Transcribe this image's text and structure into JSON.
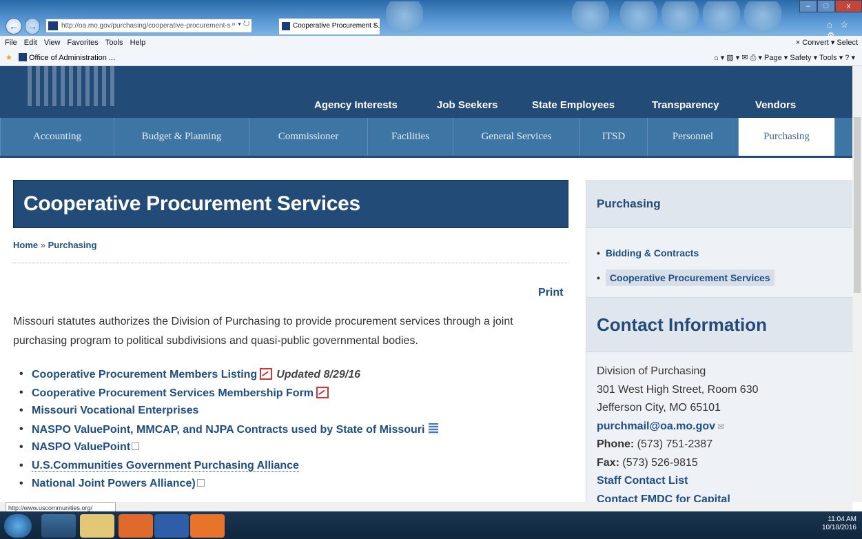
{
  "browser": {
    "url": "http://oa.mo.gov/purchasing/cooperative-procurement-s",
    "url_tools": "⌕ ▾ ↻",
    "tab_title": "Cooperative Procurement S...",
    "tab_close": "×",
    "window_controls": [
      "–",
      "□",
      "x"
    ],
    "toolbar_icons": "⌂ ☆ ⚙",
    "menu": [
      "File",
      "Edit",
      "View",
      "Favorites",
      "Tools",
      "Help"
    ],
    "menu_right": "×  Convert ▾  Select",
    "favorite": "Office of Administration ...",
    "command_bar": "⌂ ▾  ▧ ▾  ✉  ⎙ ▾  Page ▾  Safety ▾  Tools ▾  ? ▾",
    "status_url": "http://www.uscommunities.org/"
  },
  "nav": {
    "top": [
      "Agency Interests",
      "Job Seekers",
      "State Employees",
      "Transparency",
      "Vendors"
    ],
    "sub": [
      "Accounting",
      "Budget & Planning",
      "Commissioner",
      "Facilities",
      "General Services",
      "ITSD",
      "Personnel",
      "Purchasing"
    ],
    "active": "Purchasing"
  },
  "main": {
    "title": "Cooperative Procurement Services",
    "breadcrumb": {
      "home": "Home",
      "sep": "»",
      "current": "Purchasing"
    },
    "print": "Print",
    "intro": "Missouri statutes authorizes the Division of Purchasing to provide procurement services through a joint purchasing program to political subdivisions and quasi-public governmental bodies.",
    "links": [
      {
        "text": "Cooperative Procurement Members Listing",
        "note": "Updated 8/29/16"
      },
      {
        "text": "Cooperative Procurement Services Membership Form"
      },
      {
        "text": "Missouri Vocational Enterprises"
      },
      {
        "text": "NASPO ValuePoint, MMCAP, and NJPA Contracts used by State of Missouri"
      },
      {
        "text": "NASPO ValuePoint"
      },
      {
        "text": "U.S.Communities Government Purchasing Alliance"
      },
      {
        "text": "National Joint Powers Alliance)"
      }
    ]
  },
  "sidebar": {
    "heading": "Purchasing",
    "items": [
      "Bidding & Contracts",
      "Cooperative Procurement Services"
    ],
    "contact_heading": "Contact Information",
    "contact": {
      "org": "Division of Purchasing",
      "street": "301 West High Street, Room 630",
      "city": "Jefferson City, MO 65101",
      "email": "purchmail@oa.mo.gov",
      "phone_label": "Phone:",
      "phone": "(573) 751-2387",
      "fax_label": "Fax:",
      "fax": "(573) 526-9815",
      "staff": "Staff Contact List",
      "fmdc": "Contact FMDC for Capital"
    }
  },
  "taskbar": {
    "time": "11:04 AM",
    "date": "10/18/2016"
  }
}
